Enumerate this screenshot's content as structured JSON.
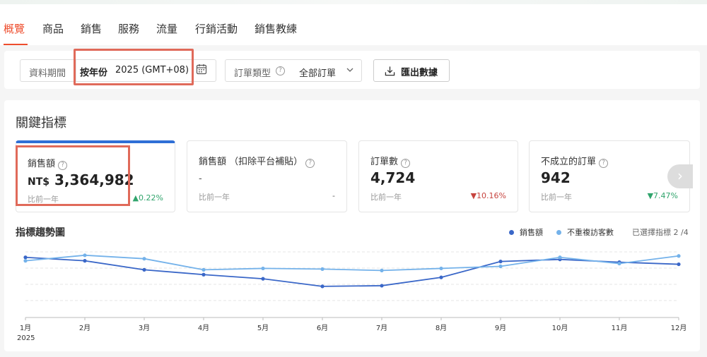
{
  "tabs": [
    "概覽",
    "商品",
    "銷售",
    "服務",
    "流量",
    "行銷活動",
    "銷售教練"
  ],
  "filters": {
    "date_label": "資料期間",
    "date_mode": "按年份",
    "date_value": "2025 (GMT+08)",
    "order_type_label": "訂單類型",
    "order_type_value": "全部訂單",
    "export_label": "匯出數據"
  },
  "section_title": "關鍵指標",
  "metrics": [
    {
      "title": "銷售額",
      "currency": "NT$",
      "value": "3,364,982",
      "sub": "比前一年",
      "change": "0.22%",
      "direction": "up"
    },
    {
      "title": "銷售額 （扣除平台補貼）",
      "currency": "",
      "value": "-",
      "sub": "比前一年",
      "change": "-",
      "direction": "none"
    },
    {
      "title": "訂單數",
      "currency": "",
      "value": "4,724",
      "sub": "比前一年",
      "change": "10.16%",
      "direction": "down"
    },
    {
      "title": "不成立的訂單",
      "currency": "",
      "value": "942",
      "sub": "比前一年",
      "change": "7.47%",
      "direction": "down"
    }
  ],
  "trend": {
    "title": "指標趨勢圖",
    "selected_label": "已選擇指標 2 /4"
  },
  "colors": {
    "accent": "#ee4d2d",
    "series1": "#3a67c8",
    "series2": "#74b2ea",
    "up": "#30a46c",
    "down": "#c7443f"
  },
  "chart_data": {
    "type": "line",
    "x": [
      "1月",
      "2月",
      "3月",
      "4月",
      "5月",
      "6月",
      "7月",
      "8月",
      "9月",
      "10月",
      "11月",
      "12月"
    ],
    "x_sub": "2025",
    "ylim": [
      0,
      100
    ],
    "grid": true,
    "legend_position": "top-right",
    "series": [
      {
        "name": "銷售額",
        "color": "#3a67c8",
        "values": [
          87,
          82,
          69,
          62,
          56,
          45,
          46,
          58,
          81,
          84,
          80,
          77
        ]
      },
      {
        "name": "不重複訪客數",
        "color": "#74b2ea",
        "values": [
          82,
          90,
          85,
          69,
          71,
          70,
          68,
          71,
          74,
          87,
          78,
          89
        ]
      }
    ]
  }
}
